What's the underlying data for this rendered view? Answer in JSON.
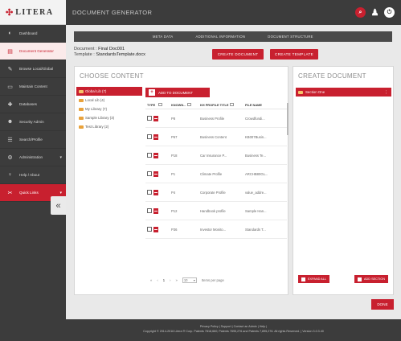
{
  "brand": {
    "logo_text": "LITERA"
  },
  "topbar": {
    "title": "DOCUMENT GENERATOR"
  },
  "sidebar": {
    "items": [
      {
        "label": "Dashboard",
        "icon": "speedometer-icon"
      },
      {
        "label": "Document Generator",
        "icon": "document-icon"
      },
      {
        "label": "Browse Local/Global",
        "icon": "pen-icon"
      },
      {
        "label": "Maintain Content",
        "icon": "folder-icon"
      },
      {
        "label": "Databases",
        "icon": "puzzle-icon"
      },
      {
        "label": "Security Admin",
        "icon": "users-icon"
      },
      {
        "label": "Search/Profile",
        "icon": "list-icon"
      },
      {
        "label": "Administration",
        "icon": "gear-icon"
      },
      {
        "label": "Help / About",
        "icon": "bulb-icon"
      },
      {
        "label": "Quick Links",
        "icon": "link-icon"
      }
    ],
    "collapse_label": "«"
  },
  "tabs": [
    "META DATA",
    "ADDITIONAL INFORMATION",
    "DOCUMENT STRUCTURE"
  ],
  "document": {
    "doc_label": "Document :",
    "doc_value": "Final Doc001",
    "template_label": "Template :",
    "template_value": "StandardsTemplate.docx"
  },
  "buttons": {
    "create_document": "CREATE DOCUMENT",
    "create_template": "CREATE TEMPLATE",
    "add_to_document": "ADD TO DOCUMENT",
    "expand_all": "EXPAND ALL",
    "add_section": "ADD SECTION",
    "done": "DONE"
  },
  "choose_content": {
    "title": "CHOOSE CONTENT",
    "tree": [
      "Global Lib (7)",
      "Local Lib (4)",
      "My Library (7)",
      "Sample Library (3)",
      "Test Library (2)"
    ],
    "columns": [
      "TYPE",
      "KNOWN...",
      "KH PROFILE TITLE",
      "FILE NAME"
    ],
    "rows": [
      {
        "known": "P8",
        "profile": "Business Profile",
        "file": "Crowdfundi..."
      },
      {
        "known": "P67",
        "profile": "Business Content",
        "file": "KB007Busin..."
      },
      {
        "known": "P18",
        "profile": "Car Insurance P...",
        "file": "Business Te..."
      },
      {
        "known": "P1",
        "profile": "Climate Profile",
        "file": "ARCHB80GL..."
      },
      {
        "known": "P4",
        "profile": "Corporate Profile",
        "file": "value_addre..."
      },
      {
        "known": "P12",
        "profile": "Handbook profile",
        "file": "Sample Han..."
      },
      {
        "known": "P36",
        "profile": "Investor Monito...",
        "file": "Standards T..."
      }
    ],
    "pager": {
      "first": "«",
      "prev": "‹",
      "page": "1",
      "next": "›",
      "last": "»",
      "per_page": "10",
      "per_page_label": "Items per page"
    }
  },
  "create_document": {
    "title": "CREATE DOCUMENT",
    "section": "Section One",
    "section_menu": "⋮"
  },
  "footer": {
    "links": "Privacy Policy  |  Support  |  Contact an Admin  |  Help  |",
    "copyright": "Copyright © 2014-2016 Litera ® Corp. Patents 7818,660; Patents 7895,276 and Patents 7,895,276. All rights Reserved. | Version 3.0.3.40"
  },
  "colors": {
    "accent": "#c8202f",
    "dark": "#3c3c3c",
    "folder": "#e9a23b"
  }
}
